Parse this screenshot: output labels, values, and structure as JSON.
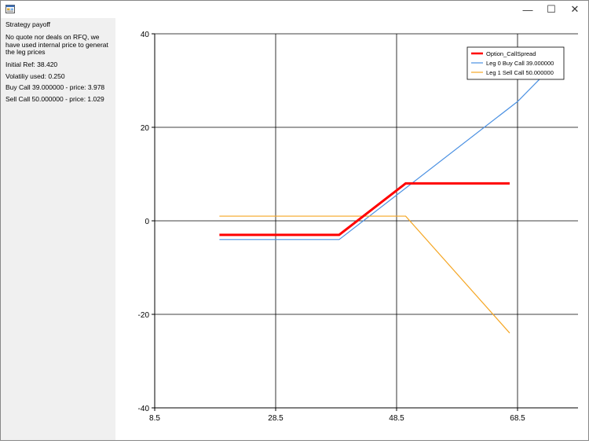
{
  "window": {
    "minimize_glyph": "—",
    "maximize_glyph": "☐",
    "close_glyph": "✕"
  },
  "sidebar": {
    "title": "Strategy payoff",
    "note": "No quote nor deals on RFQ, we have used internal price to generat the leg prices",
    "initial_ref": "Initial Ref: 38.420",
    "volatility": "Volatiliy used: 0.250",
    "buy_call": "Buy Call 39.000000 - price: 3.978",
    "sell_call": "Sell Call 50.000000 - price: 1.029"
  },
  "chart_data": {
    "type": "line",
    "title": "",
    "xlabel": "",
    "ylabel": "",
    "xlim": [
      8.5,
      78.5
    ],
    "ylim": [
      -40,
      40
    ],
    "x_ticks": [
      8.5,
      28.5,
      48.5,
      68.5
    ],
    "x_tick_labels": [
      "8.5",
      "28.5",
      "48.5",
      "68.5"
    ],
    "y_ticks": [
      -40,
      -20,
      0,
      20,
      40
    ],
    "y_tick_labels": [
      "-40",
      "-20",
      "0",
      "20",
      "40"
    ],
    "grid": true,
    "legend": "top-right",
    "series": [
      {
        "name": "Option_CallSpread",
        "color": "#ff0000",
        "width": 3,
        "x": [
          19.2,
          39,
          50,
          67.2
        ],
        "y": [
          -3,
          -3,
          8,
          8
        ]
      },
      {
        "name": "Leg 0 Buy Call 39.000000",
        "color": "#4a90e2",
        "width": 1.2,
        "x": [
          19.2,
          39,
          68.5,
          72.3
        ],
        "y": [
          -4,
          -4,
          25.5,
          30.5
        ]
      },
      {
        "name": "Leg 1 Sell Call 50.000000",
        "color": "#f5a623",
        "width": 1.2,
        "x": [
          19.2,
          50,
          67.2
        ],
        "y": [
          1,
          1,
          -24
        ]
      }
    ]
  }
}
